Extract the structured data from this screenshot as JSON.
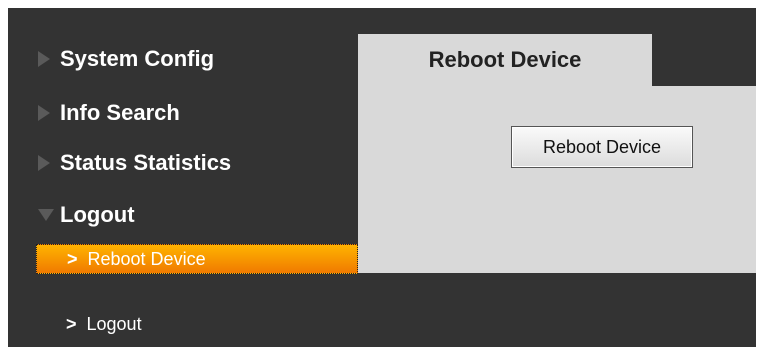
{
  "sidebar": {
    "items": [
      {
        "label": "System Config",
        "icon": "arrow-right-icon",
        "expanded": false
      },
      {
        "label": "Info Search",
        "icon": "arrow-right-icon",
        "expanded": false
      },
      {
        "label": "Status Statistics",
        "icon": "arrow-right-icon",
        "expanded": false
      },
      {
        "label": "Logout",
        "icon": "arrow-down-icon",
        "expanded": true
      }
    ],
    "subitems": [
      {
        "label": "Reboot Device",
        "active": true
      },
      {
        "label": "Logout",
        "active": false
      }
    ],
    "chevron": ">"
  },
  "main": {
    "tab_label": "Reboot Device",
    "button_label": "Reboot Device"
  },
  "colors": {
    "background": "#333333",
    "panel": "#d9d9d9",
    "active_start": "#ffb300",
    "active_end": "#f07a00"
  }
}
